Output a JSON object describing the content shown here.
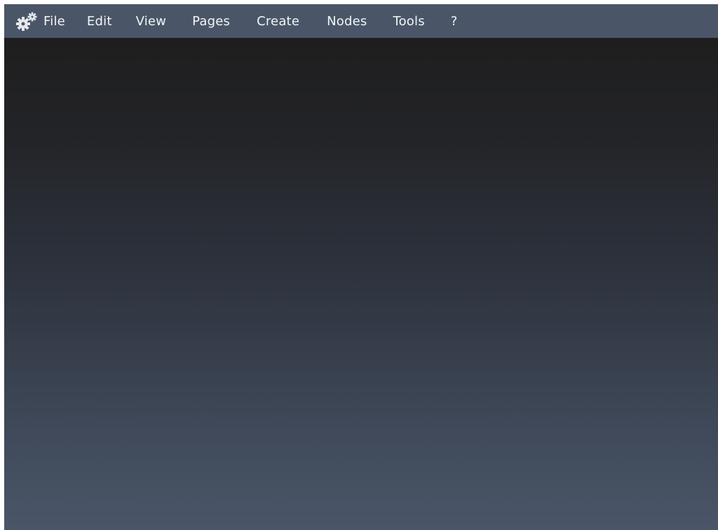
{
  "menubar": {
    "app_icon": "gears-icon",
    "items": [
      {
        "label": "File"
      },
      {
        "label": "Edit"
      },
      {
        "label": "View"
      },
      {
        "label": "Pages"
      },
      {
        "label": "Create"
      },
      {
        "label": "Nodes"
      },
      {
        "label": "Tools"
      },
      {
        "label": "?"
      }
    ]
  },
  "colors": {
    "menubar_bg": "#4a5668",
    "menu_text": "#f2f4f7",
    "viewport_top": "#1e1e1e",
    "viewport_bottom": "#4a5668"
  }
}
